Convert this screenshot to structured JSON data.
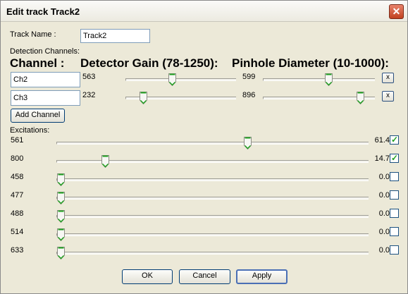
{
  "window": {
    "title": "Edit track Track2",
    "close_glyph": "✕"
  },
  "track_name": {
    "label": "Track Name :",
    "value": "Track2"
  },
  "detection": {
    "label": "Detection Channels:",
    "header_channel": "Channel :",
    "header_gain": "Detector Gain (78-1250):",
    "header_pinhole": "Pinhole Diameter (10-1000):",
    "channels": [
      {
        "name": "Ch2",
        "gain": "563",
        "gain_value": 563,
        "pinhole": "599",
        "pinhole_value": 599,
        "remove": "x"
      },
      {
        "name": "Ch3",
        "gain": "232",
        "gain_value": 232,
        "pinhole": "896",
        "pinhole_value": 896,
        "remove": "x"
      }
    ],
    "gain_range": [
      78,
      1250
    ],
    "pinhole_range": [
      10,
      1000
    ],
    "add_button": "Add Channel"
  },
  "excitations": {
    "label": "Excitations:",
    "lines": [
      {
        "wavelength": "561",
        "power": "61.4",
        "level": 0.614,
        "checked": true
      },
      {
        "wavelength": "800",
        "power": "14.7",
        "level": 0.147,
        "checked": true
      },
      {
        "wavelength": "458",
        "power": "0.0",
        "level": 0.0,
        "checked": false
      },
      {
        "wavelength": "477",
        "power": "0.0",
        "level": 0.0,
        "checked": false
      },
      {
        "wavelength": "488",
        "power": "0.0",
        "level": 0.0,
        "checked": false
      },
      {
        "wavelength": "514",
        "power": "0.0",
        "level": 0.0,
        "checked": false
      },
      {
        "wavelength": "633",
        "power": "0.0",
        "level": 0.0,
        "checked": false
      }
    ]
  },
  "buttons": {
    "ok": "OK",
    "cancel": "Cancel",
    "apply": "Apply"
  },
  "colors": {
    "thumb_accent": "#21a121",
    "window_bg": "#ece9d8"
  }
}
